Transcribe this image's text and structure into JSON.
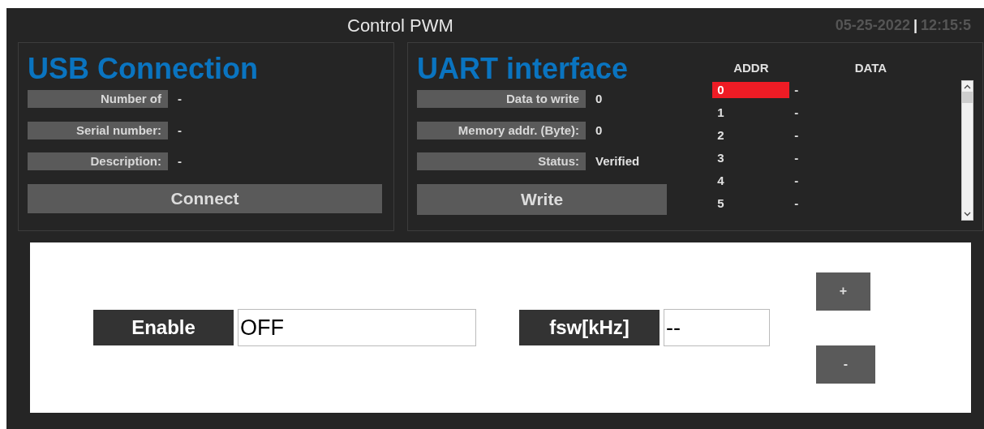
{
  "header": {
    "title": "Control PWM",
    "date": "05-25-2022",
    "separator": "|",
    "time": "12:15:5"
  },
  "usb": {
    "title": "USB Connection",
    "fields": [
      {
        "label": "Number of",
        "value": "-"
      },
      {
        "label": "Serial number:",
        "value": "-"
      },
      {
        "label": "Description:",
        "value": "-"
      }
    ],
    "button": "Connect"
  },
  "uart": {
    "title": "UART interface",
    "fields": [
      {
        "label": "Data to write",
        "value": "0"
      },
      {
        "label": "Memory addr. (Byte):",
        "value": "0"
      },
      {
        "label": "Status:",
        "value": "Verified"
      }
    ],
    "button": "Write"
  },
  "memory_table": {
    "columns": [
      "ADDR",
      "DATA"
    ],
    "rows": [
      {
        "addr": "0",
        "data": "-",
        "selected": true
      },
      {
        "addr": "1",
        "data": "-",
        "selected": false
      },
      {
        "addr": "2",
        "data": "-",
        "selected": false
      },
      {
        "addr": "3",
        "data": "-",
        "selected": false
      },
      {
        "addr": "4",
        "data": "-",
        "selected": false
      },
      {
        "addr": "5",
        "data": "-",
        "selected": false
      }
    ]
  },
  "control": {
    "enable_label": "Enable",
    "enable_value": "OFF",
    "fsw_label": "fsw[kHz]",
    "fsw_value": "--",
    "plus": "+",
    "minus": "-"
  }
}
